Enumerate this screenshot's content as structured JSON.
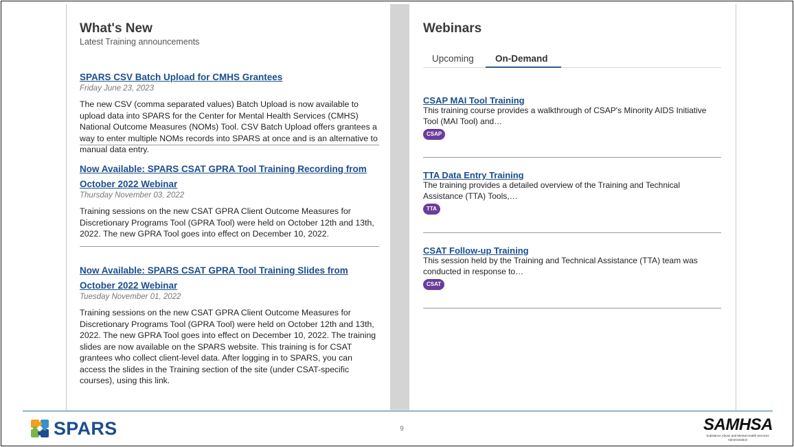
{
  "whats_new": {
    "title": "What's New",
    "subtitle": "Latest Training announcements",
    "items": [
      {
        "title": "SPARS CSV Batch Upload for CMHS Grantees",
        "date": "Friday June 23, 2023",
        "body": "The new CSV (comma separated values) Batch Upload is now available to upload data into SPARS for the Center for Mental Health Services (CMHS) National Outcome Measures (NOMs) Tool. CSV Batch Upload offers grantees a way to enter multiple NOMs records into SPARS at once and is an alternative to manual data entry."
      },
      {
        "title": "Now Available: SPARS CSAT GPRA Tool Training Recording from October 2022 Webinar",
        "date": "Thursday November 03, 2022",
        "body": "Training sessions on the new CSAT GPRA Client Outcome Measures for Discretionary Programs Tool (GPRA Tool) were held on October 12th and 13th, 2022. The new GPRA Tool goes into effect on December 10, 2022."
      },
      {
        "title": "Now Available: SPARS CSAT GPRA Tool Training Slides from October 2022 Webinar",
        "date": "Tuesday November 01, 2022",
        "body": "Training sessions on the new CSAT GPRA Client Outcome Measures for Discretionary Programs Tool (GPRA Tool) were held on October 12th and 13th, 2022. The new GPRA Tool goes into effect on December 10, 2022. The training slides are now available on the SPARS website. This training is for CSAT grantees who collect client-level data. After logging in to SPARS, you can access the slides in the Training section of the site (under CSAT-specific courses), using this link."
      }
    ]
  },
  "webinars": {
    "title": "Webinars",
    "tabs": [
      {
        "label": "Upcoming",
        "active": false
      },
      {
        "label": "On-Demand",
        "active": true
      }
    ],
    "items": [
      {
        "title": "CSAP MAI Tool Training",
        "desc": "This training course provides a walkthrough of CSAP's Minority AIDS Initiative Tool (MAI Tool) and…",
        "badge": "CSAP"
      },
      {
        "title": "TTA Data Entry Training",
        "desc": "The training provides a detailed overview of the Training and Technical Assistance (TTA) Tools,…",
        "badge": "TTA"
      },
      {
        "title": "CSAT Follow-up Training",
        "desc": "This session held by the Training and Technical Assistance (TTA) team was conducted in response to…",
        "badge": "CSAT"
      }
    ]
  },
  "footer": {
    "spars_logo_text": "SPARS",
    "page_number": "9",
    "samhsa_logo_text": "SAMHSA",
    "samhsa_subtext": "Substance Abuse and Mental Health Services Administration"
  },
  "colors": {
    "link": "#1b4e8f",
    "badge": "#6a3d9a",
    "divider": "#d4d4d4",
    "footer_rule": "#2f6f8f"
  },
  "icons": {
    "spars_logo": "spars-puzzle-icon"
  }
}
